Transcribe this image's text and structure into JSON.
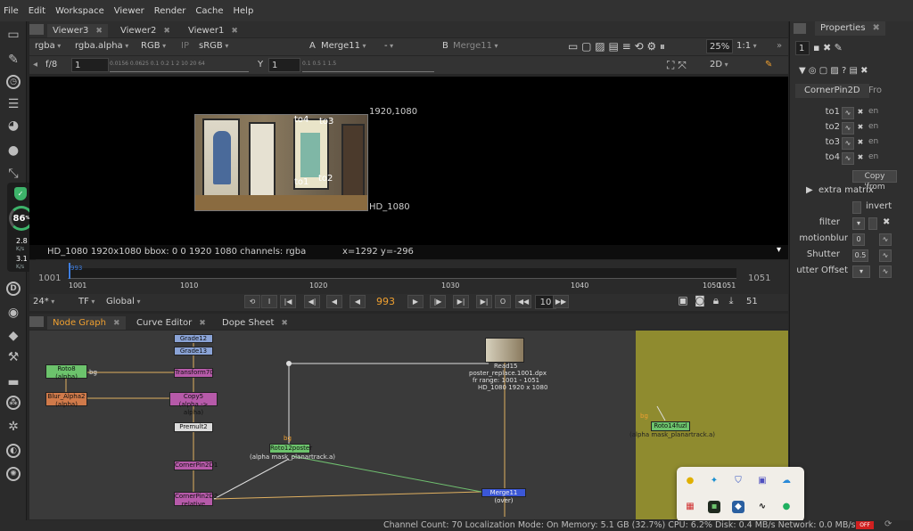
{
  "menu": [
    "File",
    "Edit",
    "Workspace",
    "Viewer",
    "Render",
    "Cache",
    "Help"
  ],
  "viewer_tabs": [
    "Viewer3",
    "Viewer2",
    "Viewer1"
  ],
  "viewer_controls": {
    "channels": "rgba",
    "alpha": "rgba.alpha",
    "display": "RGB",
    "ip": "IP",
    "colorspace": "sRGB",
    "input_a_label": "A",
    "input_a": "Merge11",
    "op": "-",
    "input_b_label": "B",
    "input_b": "Merge11",
    "zoom": "25%",
    "proxy": "1:1"
  },
  "viewer_row2": {
    "fstop": "f/8",
    "frame_label": "1",
    "y_label": "Y",
    "y_value": "1",
    "mode": "2D",
    "gain_ticks": "0.0156 0.0625 0.1 0.2   1   2   10  20 64",
    "gamma_ticks": "0.1   0.5   1   1.5"
  },
  "viewer_overlay": {
    "res_tr": "1920,1080",
    "format": "HD_1080",
    "to4": "to4",
    "to3": "to3",
    "to1": "to1",
    "to2": "to2"
  },
  "info_bar": {
    "left": "HD_1080 1920x1080  bbox: 0 0 1920 1080 channels: rgba",
    "coords": "x=1292 y=-296"
  },
  "timeline": {
    "in_frame": "1001",
    "out_frame": "1051",
    "current_marker": "993",
    "ticks": [
      "1001",
      "1010",
      "1020",
      "1030",
      "1040",
      "1050",
      "1051"
    ],
    "fps": "24*",
    "tf": "TF",
    "scope": "Global",
    "current_frame": "993",
    "step": "10",
    "end_frame": "51"
  },
  "panel_tabs": [
    "Node Graph",
    "Curve Editor",
    "Dope Sheet"
  ],
  "nodes": {
    "grade12": "Grade12",
    "grade13": "Grade13",
    "transform70": "Transform70",
    "roto8": "Roto8",
    "roto8_sub": "(alpha)",
    "blur": "Blur_Alpha2",
    "blur_sub": "(alpha)",
    "copy5": "Copy5",
    "copy5_sub": "(alpha -> alpha)",
    "premult": "Premult2",
    "cornerpin1": "CornerPin2D1",
    "cornerpin2": "CornerPin2D2",
    "cornerpin2_sub": "relative",
    "roto12": "Roto12poster",
    "roto12_sub": "(alpha mask_planartrack.a)",
    "read15": "Read15",
    "read15_file": "poster_replace.1001.dpx",
    "read15_range": "fr range: 1001 - 1051",
    "read15_fmt": "HD_1080 1920 x 1080",
    "merge11": "Merge11 (over)",
    "roto14": "Roto14fuzl",
    "roto14_sub": "(alpha mask_planartrack.a)",
    "bg": "bg",
    "bg2": "bg",
    "bg3": "bg"
  },
  "properties": {
    "title": "Properties",
    "node_name": "CornerPin2D",
    "tab2": "Fro",
    "to_rows": [
      "to1",
      "to2",
      "to3",
      "to4"
    ],
    "copy_from": "Copy 'from",
    "extra_matrix": "extra matrix",
    "invert": "invert",
    "filter": "filter",
    "motionblur": "motionblur",
    "motionblur_val": "0",
    "shutter": "Shutter",
    "shutter_val": "0.5",
    "shutter_offset": "utter Offset",
    "panel_count": "1"
  },
  "netmon": {
    "percent": "86",
    "up": "2.8",
    "down": "3.1",
    "unit": "K/s"
  },
  "status": "Channel Count: 70  Localization Mode: On  Memory: 5.1 GB (32.7%) CPU: 6.2% Disk: 0.4 MB/s Network: 0.0 MB/s",
  "status_badge": "OFF",
  "colors": {
    "roto": "#6cc36c",
    "grade": "#8aa3d6",
    "copy": "#b65aa9",
    "blur": "#d07a4a",
    "merge": "#3b57d6",
    "backdrop": "#8f8b2f",
    "accent": "#f0a030"
  }
}
